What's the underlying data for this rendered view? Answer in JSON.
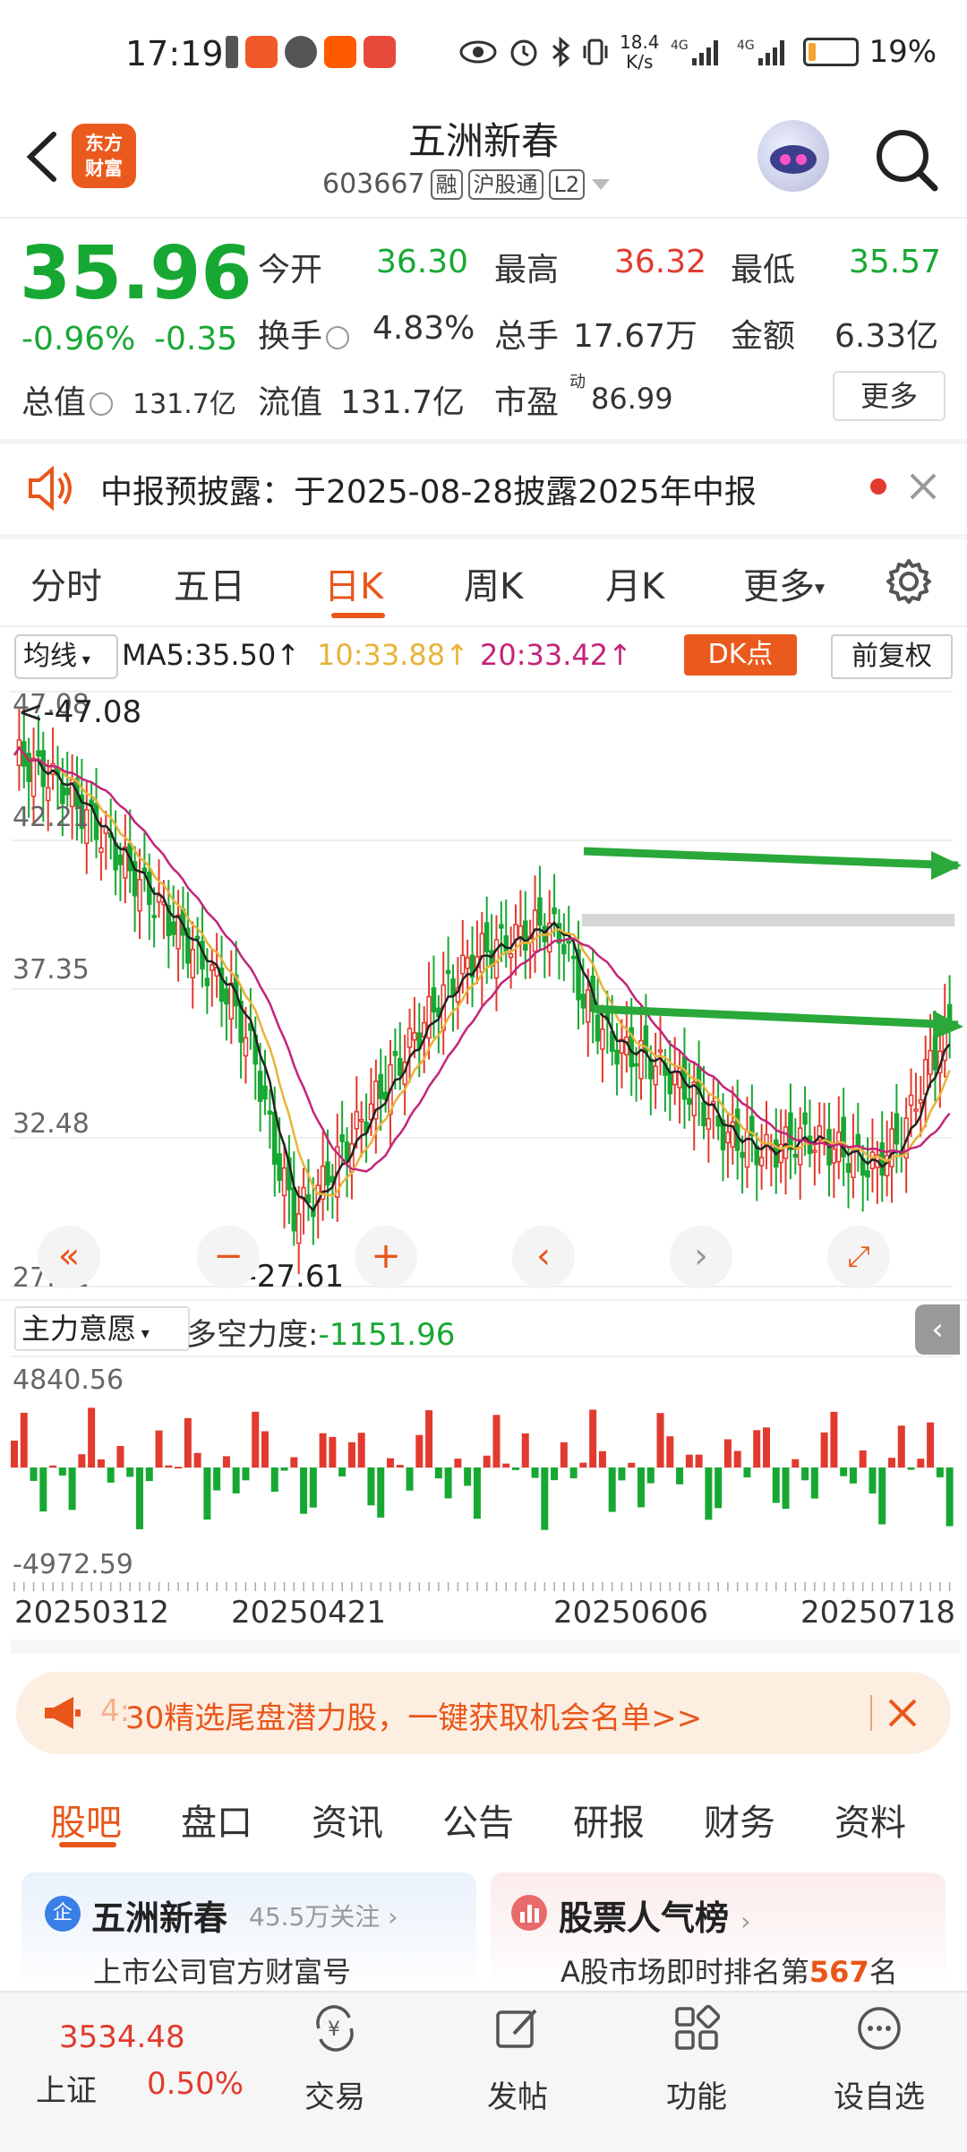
{
  "status_bar": {
    "time": "17:19",
    "net_speed": [
      "18.4",
      "K/s"
    ],
    "signal_label": "4G",
    "battery_percent": "19%",
    "battery_level": 0.19
  },
  "header": {
    "logo_text": [
      "东方",
      "财富"
    ],
    "stock_name": "五洲新春",
    "stock_code": "603667",
    "tags": [
      "融",
      "沪股通",
      "L2"
    ]
  },
  "quote": {
    "price": "35.96",
    "change_pct": "-0.96%",
    "change_abs": "-0.35",
    "open_label": "今开",
    "open": "36.30",
    "high_label": "最高",
    "high": "36.32",
    "low_label": "最低",
    "low": "35.57",
    "turnover_label": "换手",
    "turnover": "4.83%",
    "volume_label": "总手",
    "volume": "17.67万",
    "amount_label": "金额",
    "amount": "6.33亿",
    "mktcap_label": "总值",
    "mktcap": "131.7亿",
    "float_label": "流值",
    "float_cap": "131.7亿",
    "pe_label": "市盈",
    "pe_sup": "动",
    "pe": "86.99",
    "more_label": "更多"
  },
  "notice": {
    "text": "中报预披露：于2025-08-28披露2025年中报"
  },
  "chart_tabs": {
    "items": [
      "分时",
      "五日",
      "日K",
      "周K",
      "月K",
      "更多"
    ],
    "active": 2
  },
  "ma_bar": {
    "select_label": "均线",
    "ma5": "MA5:35.50",
    "ma10": "10:33.88",
    "ma20": "20:33.42",
    "dk_label": "DK点",
    "adjust_label": "前复权"
  },
  "chart_data": {
    "type": "candlestick",
    "y_ticks": [
      "47.08",
      "42.21",
      "37.35",
      "32.48",
      "27.61"
    ],
    "ylim": [
      27.61,
      47.08
    ],
    "high_marker": "<-47.08",
    "low_marker": "<-27.61",
    "colors": {
      "up": "#e23a2e",
      "down": "#17a833",
      "ma5": "#222222",
      "ma10": "#e8b33a",
      "ma20": "#c4247a"
    }
  },
  "indicator": {
    "select_label": "主力意愿",
    "label": "多空力度:",
    "value": "-1151.96",
    "y_max": "4840.56",
    "y_min": "-4972.59"
  },
  "dates": [
    "20250312",
    "20250421",
    "20250606",
    "20250718"
  ],
  "banner": {
    "prefix": "4:",
    "text": "30精选尾盘潜力股，一键获取机会名单>>"
  },
  "bottom_tabs": {
    "items": [
      "股吧",
      "盘口",
      "资讯",
      "公告",
      "研报",
      "财务",
      "资料"
    ],
    "active": 0
  },
  "cards": {
    "left_title": "五洲新春",
    "left_badge": "企",
    "left_follow": "45.5万关注",
    "left_sub": "上市公司官方财富号",
    "right_title": "股票人气榜",
    "right_sub_prefix": "A股市场即时排名第",
    "right_rank": "567",
    "right_sub_suffix": "名"
  },
  "footer": {
    "index_value": "3534.48",
    "index_name": "上证",
    "index_change": "0.50%",
    "items": [
      "交易",
      "发帖",
      "功能",
      "设自选"
    ]
  }
}
